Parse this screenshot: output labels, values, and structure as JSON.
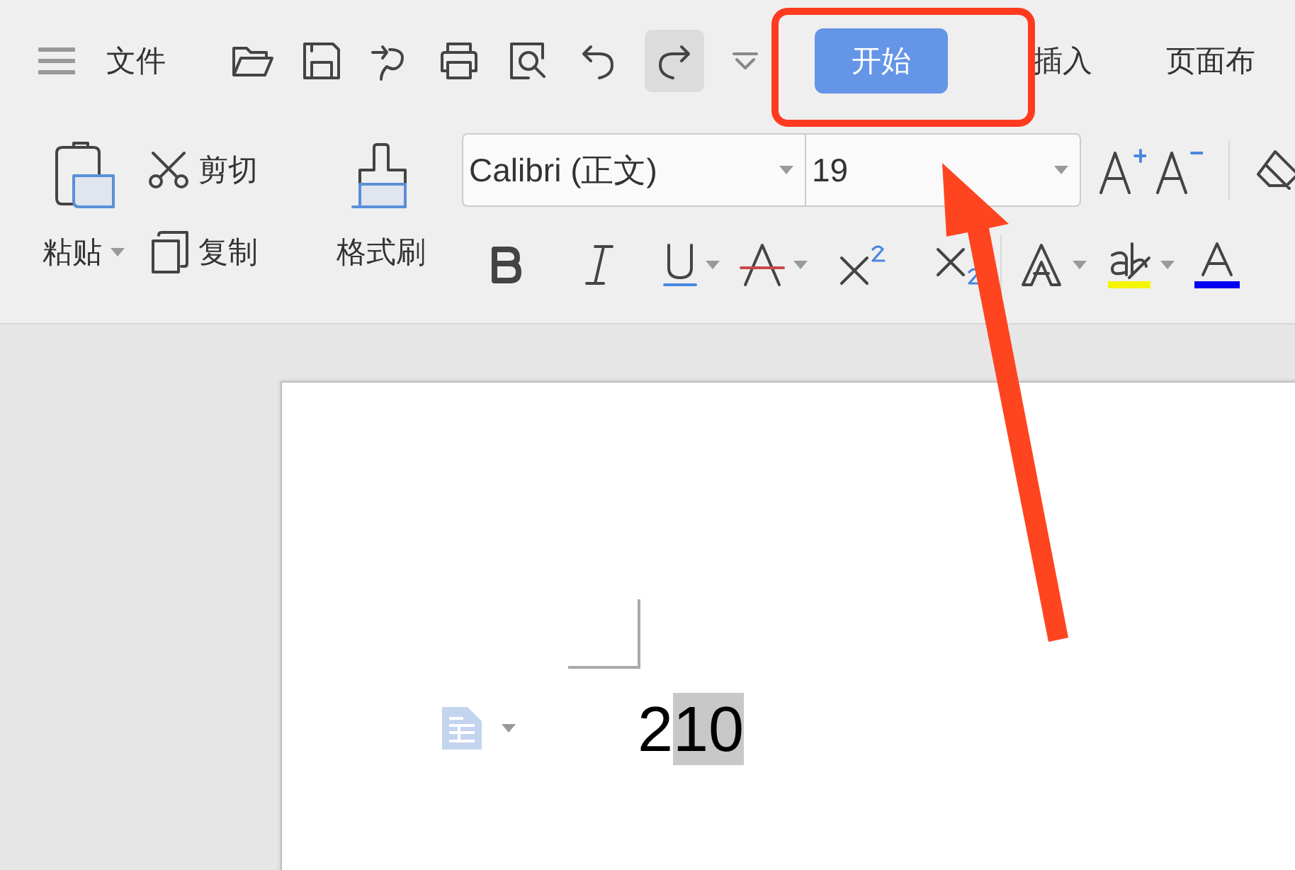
{
  "menu": {
    "file_label": "文件"
  },
  "tabs": [
    {
      "label": "开始",
      "selected": true
    },
    {
      "label": "插入",
      "selected": false
    },
    {
      "label": "页面布",
      "selected": false
    }
  ],
  "clipboard": {
    "paste": "粘贴",
    "cut": "剪切",
    "copy": "复制",
    "format_painter": "格式刷"
  },
  "font": {
    "name": "Calibri (正文)",
    "size": "19"
  },
  "document": {
    "runs": [
      {
        "text": "2",
        "selected": false
      },
      {
        "text": "10",
        "selected": true
      }
    ]
  }
}
